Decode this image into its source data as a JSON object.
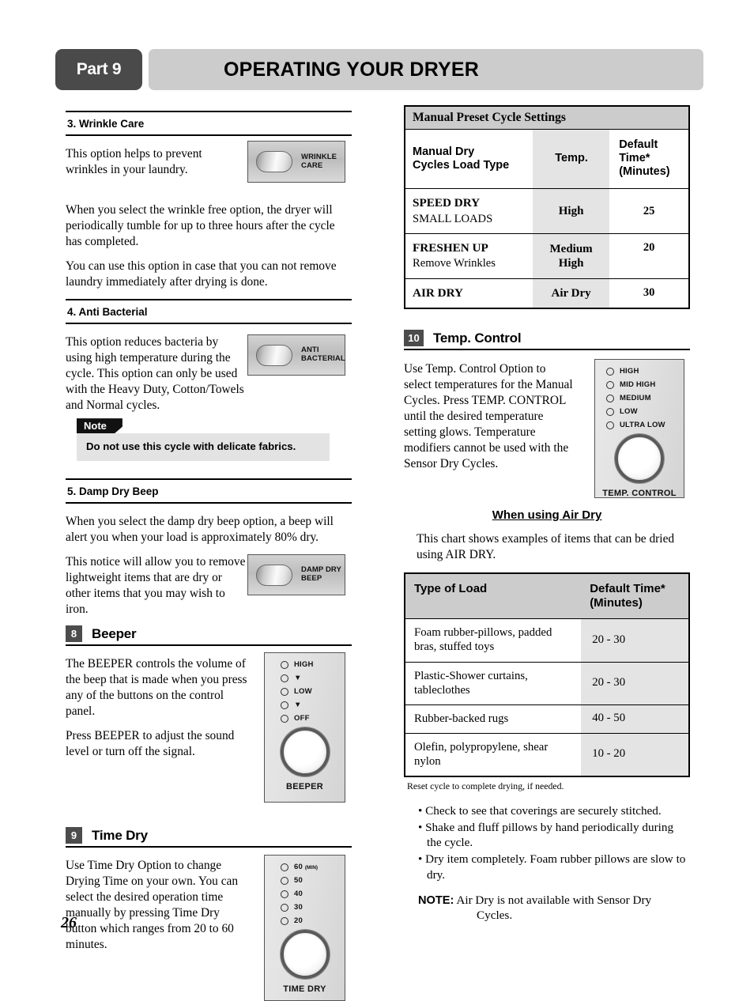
{
  "header": {
    "part_badge": "Part 9",
    "title": "OPERATING YOUR DRYER"
  },
  "page_number": "26",
  "left_column": {
    "wrinkle_care": {
      "heading": "3. Wrinkle Care",
      "paragraphs": [
        "This option helps to prevent wrinkles in your laundry.",
        "When you select the wrinkle free option, the dryer will periodically tumble for up to three hours after the cycle has completed.",
        "You can use this option in case that you can not remove laundry immediately after drying is done."
      ],
      "switch_label_line1": "WRINKLE",
      "switch_label_line2": "CARE"
    },
    "anti_bacterial": {
      "heading": "4. Anti Bacterial",
      "paragraph": "This option reduces bacteria by using high temperature during the cycle.  This option can only be used with the Heavy Duty, Cotton/Towels and Normal cycles.",
      "switch_label_line1": "ANTI",
      "switch_label_line2": "BACTERIAL",
      "note_tag": "Note",
      "note_text": "Do not use this cycle with delicate fabrics."
    },
    "damp_dry_beep": {
      "heading": "5. Damp Dry Beep",
      "paragraphs": [
        "When you select the damp dry beep option, a beep will alert you when your load is approximately 80% dry.",
        "This notice will allow you to remove lightweight items that are dry or other items that you may wish to iron."
      ],
      "switch_label_line1": "DAMP DRY",
      "switch_label_line2": "BEEP"
    },
    "beeper": {
      "number": "8",
      "heading": "Beeper",
      "paragraphs": [
        "The BEEPER controls the volume of the beep that is made when you press any of the buttons on the control panel.",
        "Press BEEPER to adjust the sound level or turn off the signal."
      ],
      "panel_lamps": [
        "HIGH",
        "▼",
        "LOW",
        "▼",
        "OFF"
      ],
      "knob_caption": "BEEPER"
    },
    "time_dry": {
      "number": "9",
      "heading": "Time Dry",
      "paragraph": "Use Time Dry Option to change Drying Time on your own. You can select the desired operation time manually by pressing Time Dry button which ranges from 20 to 60 minutes.",
      "panel_lamps": [
        "60 (MIN)",
        "50",
        "40",
        "30",
        "20"
      ],
      "knob_caption": "TIME DRY"
    }
  },
  "right_column": {
    "preset_table": {
      "title": "Manual Preset Cycle Settings",
      "headers": [
        "Manual Dry\nCycles Load Type",
        "Temp.",
        "Default Time*\n(Minutes)"
      ],
      "header_col1_line1": "Manual Dry",
      "header_col1_line2": "Cycles Load Type",
      "header_col2": "Temp.",
      "header_col3_line1": "Default Time*",
      "header_col3_line2": "(Minutes)",
      "rows": [
        {
          "load_bold": "SPEED DRY",
          "load_sub": "SMALL LOADS",
          "temp": "High",
          "time": "25"
        },
        {
          "load_bold": "FRESHEN UP",
          "load_sub": "Remove Wrinkles",
          "temp": "Medium\nHigh",
          "temp_line1": "Medium",
          "temp_line2": "High",
          "time": "20"
        },
        {
          "load_bold": "AIR DRY",
          "load_sub": "",
          "temp": "Air Dry",
          "time": "30"
        }
      ]
    },
    "temp_control": {
      "number": "10",
      "heading": "Temp. Control",
      "paragraph": "Use Temp. Control Option to select temperatures for the Manual Cycles. Press TEMP. CONTROL until the desired temperature setting glows. Temperature modifiers cannot be used with the Sensor Dry Cycles.",
      "panel_lamps": [
        "HIGH",
        "MID HIGH",
        "MEDIUM",
        "LOW",
        "ULTRA LOW"
      ],
      "knob_caption": "TEMP. CONTROL"
    },
    "air_dry": {
      "subhead": "When using Air Dry",
      "intro": "This chart shows examples of items that can be dried using AIR DRY.",
      "table": {
        "header_col1": "Type of Load",
        "header_col2_line1": "Default Time*",
        "header_col2_line2": "(Minutes)",
        "rows": [
          {
            "item": "Foam rubber-pillows, padded bras, stuffed toys",
            "time": "20 - 30"
          },
          {
            "item": "Plastic-Shower curtains, tableclothes",
            "time": "20 - 30"
          },
          {
            "item": "Rubber-backed rugs",
            "time": "40 - 50"
          },
          {
            "item": "Olefin, polypropylene, shear nylon",
            "time": "10 - 20"
          }
        ]
      },
      "footnote": "Reset cycle to complete drying, if needed.",
      "bullets": [
        "• Check to see that coverings are securely stitched.",
        "• Shake and fluff pillows by hand periodically during the cycle.",
        "• Dry item completely. Foam rubber pillows are slow to dry."
      ],
      "note_label": "NOTE:",
      "note_text": "Air Dry is not available with Sensor Dry",
      "note_text_line2": "Cycles."
    }
  }
}
